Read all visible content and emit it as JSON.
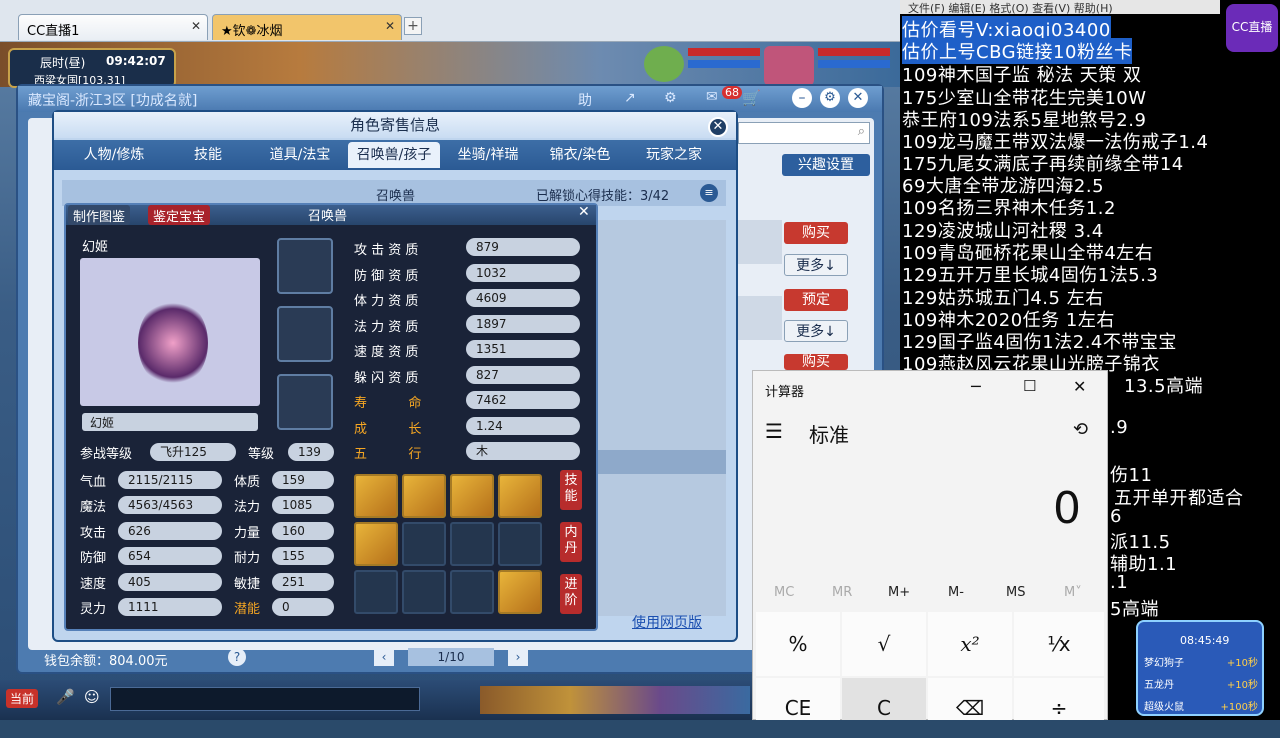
{
  "browser": {
    "tabs": [
      {
        "label": "CC直播1",
        "active": true
      },
      {
        "label": "★钦❁冰烟",
        "active": false
      }
    ]
  },
  "game_hud": {
    "time_label": "辰时(昼)",
    "clock": "09:42:07",
    "location": "西梁女国[103,31]"
  },
  "cbg": {
    "title": "藏宝阁-浙江3区 [功成名就]",
    "badge": "68",
    "interest_button": "兴趣设置",
    "wallet": "钱包余额：804.00元",
    "help": "?",
    "page": "1/10",
    "web_link": "使用网页版",
    "list_buttons": [
      {
        "type": "buy",
        "label": "购买"
      },
      {
        "type": "more",
        "label": "更多↓"
      },
      {
        "type": "buy",
        "label": "预定"
      },
      {
        "type": "more",
        "label": "更多↓"
      },
      {
        "type": "buy",
        "label": "购买"
      }
    ]
  },
  "role_panel": {
    "title": "角色寄售信息",
    "tabs": [
      "人物/修炼",
      "技能",
      "道具/法宝",
      "召唤兽/孩子",
      "坐骑/祥瑞",
      "锦衣/染色",
      "玩家之家"
    ],
    "active_tab": "召唤兽/孩子",
    "sub_title": "召唤兽",
    "unlock_skills": "已解锁心得技能：3/42"
  },
  "pet_panel": {
    "buttons": [
      "制作图鉴",
      "鉴定宝宝"
    ],
    "title": "召唤兽",
    "pet_name_top": "幻姬",
    "pet_name_box": "幻姬",
    "battle_level_label": "参战等级",
    "battle_level": "飞升125",
    "level_label": "等级",
    "level": "139",
    "stats_left": [
      {
        "label": "气血",
        "value": "2115/2115"
      },
      {
        "label": "魔法",
        "value": "4563/4563"
      },
      {
        "label": "攻击",
        "value": "626"
      },
      {
        "label": "防御",
        "value": "654"
      },
      {
        "label": "速度",
        "value": "405"
      },
      {
        "label": "灵力",
        "value": "1111"
      }
    ],
    "stats_mid": [
      {
        "label": "体质",
        "value": "159",
        "gold": false
      },
      {
        "label": "法力",
        "value": "1085",
        "gold": false
      },
      {
        "label": "力量",
        "value": "160",
        "gold": false
      },
      {
        "label": "耐力",
        "value": "155",
        "gold": false
      },
      {
        "label": "敏捷",
        "value": "251",
        "gold": false
      },
      {
        "label": "潜能",
        "value": "0",
        "gold": true
      }
    ],
    "aptitudes": [
      {
        "label": "攻 击 资 质",
        "value": "879",
        "gold": false
      },
      {
        "label": "防 御 资 质",
        "value": "1032",
        "gold": false
      },
      {
        "label": "体 力 资 质",
        "value": "4609",
        "gold": false
      },
      {
        "label": "法 力 资 质",
        "value": "1897",
        "gold": false
      },
      {
        "label": "速 度 资 质",
        "value": "1351",
        "gold": false
      },
      {
        "label": "躲 闪 资 质",
        "value": "827",
        "gold": false
      },
      {
        "label": "寿          命",
        "value": "7462",
        "gold": true
      },
      {
        "label": "成          长",
        "value": "1.24",
        "gold": true
      },
      {
        "label": "五          行",
        "value": "木",
        "gold": true
      }
    ],
    "side_tabs": [
      "技能",
      "内丹",
      "进阶"
    ]
  },
  "overlay": {
    "lines": [
      {
        "text": "估价看号V:xiaoqi03400",
        "hl": true
      },
      {
        "text": "估价上号CBG链接10粉丝卡",
        "hl": true
      },
      {
        "text": "109神木国子监  秘法 天策 双",
        "hl": false
      },
      {
        "text": "175少室山全带花生完美10W",
        "hl": false
      },
      {
        "text": "恭王府109法系5星地煞号2.9",
        "hl": false
      },
      {
        "text": "109龙马魔王带双法爆一法伤戒子1.4",
        "hl": false
      },
      {
        "text": "175九尾女满底子再续前缘全带14",
        "hl": false
      },
      {
        "text": "69大唐全带龙游四海2.5",
        "hl": false
      },
      {
        "text": "109名扬三界神木任务1.2",
        "hl": false
      },
      {
        "text": "129凌波城山河社稷  3.4",
        "hl": false
      },
      {
        "text": "109青岛砸桥花果山全带4左右",
        "hl": false
      },
      {
        "text": "129五开万里长城4固伤1法5.3",
        "hl": false
      },
      {
        "text": "129姑苏城五门4.5 左右",
        "hl": false
      },
      {
        "text": "109神木2020任务   1左右",
        "hl": false
      },
      {
        "text": "129国子监4固伤1法2.4不带宝宝",
        "hl": false
      },
      {
        "text": "109燕赵风云花果山光膀子锦衣",
        "hl": false
      }
    ],
    "partial_lines": [
      "13.5高端",
      ".9",
      "伤11",
      "五开单开都适合",
      "6",
      "派11.5",
      "辅助1.1",
      ".1",
      "5高端"
    ],
    "cc_logo": "CC直播",
    "widget_time": "08:45:49",
    "widget_rows": [
      "梦幻狗子",
      "五龙丹",
      "超级火鼠"
    ],
    "widget_values": [
      "+10秒",
      "+10秒",
      "+100秒"
    ]
  },
  "calculator": {
    "app_title": "计算器",
    "mode": "标准",
    "display": "0",
    "memory": [
      "MC",
      "MR",
      "M+",
      "M-",
      "MS",
      "M˅"
    ],
    "keys_row1": [
      "%",
      "√",
      "x²",
      "¹⁄x"
    ],
    "keys_row2": [
      "CE",
      "C",
      "⌫",
      "÷"
    ]
  },
  "bottom_bar": {
    "speaker": "当前"
  }
}
